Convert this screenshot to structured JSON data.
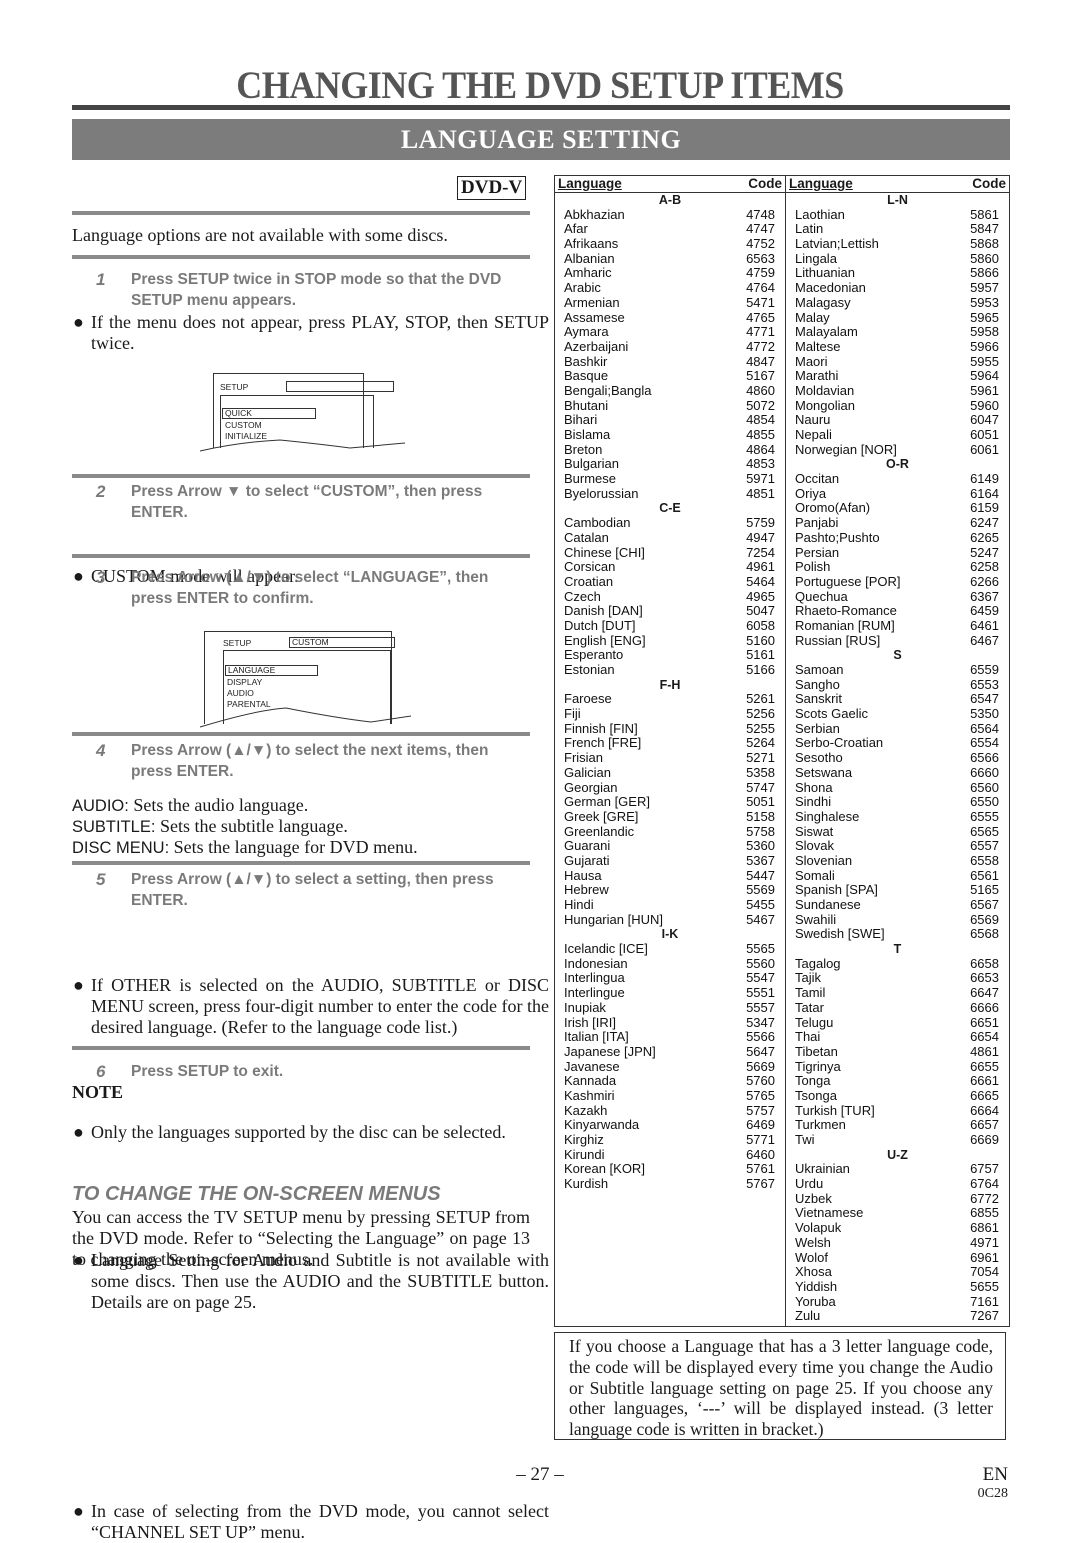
{
  "page": {
    "title": "CHANGING THE DVD SETUP ITEMS",
    "section": "LANGUAGE SETTING",
    "badge": "DVD-V",
    "intro": "Language options are not available with some discs.",
    "steps": [
      {
        "num": "1",
        "text": "Press SETUP twice in STOP mode so that the DVD SETUP menu appears."
      },
      {
        "num": "2",
        "text": "Press Arrow ▼ to select “CUSTOM”, then press ENTER."
      },
      {
        "num": "3",
        "text": "Press Arrow (▲/▼) to select “LANGUAGE”, then press ENTER to confirm."
      },
      {
        "num": "4",
        "text": "Press Arrow (▲/▼) to select the next items, then press ENTER."
      },
      {
        "num": "5",
        "text": "Press Arrow (▲/▼) to select a setting, then press ENTER."
      },
      {
        "num": "6",
        "text": "Press SETUP to exit."
      }
    ],
    "bullets": {
      "step1": "If the menu does not appear, press PLAY, STOP, then SETUP twice.",
      "step2": "CUSTOM mode will appear.",
      "step5a": "If OTHER is selected on the AUDIO, SUBTITLE or DISC MENU screen, press four-digit number to enter the code for the desired language. (Refer to the language code list.)",
      "step5b": "Only the languages supported by the disc can be selected."
    },
    "bullet_glyph": "●",
    "definitions": [
      {
        "term": "AUDIO:",
        "desc": "Sets the audio language."
      },
      {
        "term": "SUBTITLE:",
        "desc": "Sets the subtitle language."
      },
      {
        "term": "DISC MENU:",
        "desc": "Sets the language for DVD menu."
      }
    ],
    "osd1": {
      "header": "SETUP",
      "header_value": "",
      "items": [
        "QUICK",
        "CUSTOM",
        "INITIALIZE"
      ],
      "selected": "QUICK"
    },
    "osd2": {
      "header": "SETUP",
      "header_value": "CUSTOM",
      "items": [
        "LANGUAGE",
        "DISPLAY",
        "AUDIO",
        "PARENTAL"
      ],
      "selected": "LANGUAGE"
    },
    "note": {
      "heading": "NOTE",
      "text": "Language Setting for Audio and Subtitle is not available with some discs. Then use the AUDIO and the SUBTITLE button. Details are on page 25."
    },
    "onscreen": {
      "heading": "TO CHANGE THE ON-SCREEN MENUS",
      "text": "You can access the TV SETUP menu by pressing SETUP from the DVD mode. Refer to “Selecting the Language” on page 13 to changing the on-screen menus.",
      "bullet": "In case of selecting from the DVD mode, you cannot select “CHANNEL SET UP” menu."
    },
    "info_box": "If you choose a Language that has a 3 letter language code, the code will be displayed every time you change the Audio or Subtitle language setting on page 25. If you choose any other languages, ‘---’ will be displayed instead. (3 letter language code is written in bracket.)",
    "footer": {
      "page_number": "– 27 –",
      "lang": "EN",
      "model": "0C28"
    }
  },
  "table": {
    "header_language": "Language",
    "header_code": "Code",
    "columns": [
      [
        {
          "group": "A-B"
        },
        [
          "Abkhazian",
          "4748"
        ],
        [
          "Afar",
          "4747"
        ],
        [
          "Afrikaans",
          "4752"
        ],
        [
          "Albanian",
          "6563"
        ],
        [
          "Amharic",
          "4759"
        ],
        [
          "Arabic",
          "4764"
        ],
        [
          "Armenian",
          "5471"
        ],
        [
          "Assamese",
          "4765"
        ],
        [
          "Aymara",
          "4771"
        ],
        [
          "Azerbaijani",
          "4772"
        ],
        [
          "Bashkir",
          "4847"
        ],
        [
          "Basque",
          "5167"
        ],
        [
          "Bengali;Bangla",
          "4860"
        ],
        [
          "Bhutani",
          "5072"
        ],
        [
          "Bihari",
          "4854"
        ],
        [
          "Bislama",
          "4855"
        ],
        [
          "Breton",
          "4864"
        ],
        [
          "Bulgarian",
          "4853"
        ],
        [
          "Burmese",
          "5971"
        ],
        [
          "Byelorussian",
          "4851"
        ],
        {
          "group": "C-E"
        },
        [
          "Cambodian",
          "5759"
        ],
        [
          "Catalan",
          "4947"
        ],
        [
          "Chinese [CHI]",
          "7254"
        ],
        [
          "Corsican",
          "4961"
        ],
        [
          "Croatian",
          "5464"
        ],
        [
          "Czech",
          "4965"
        ],
        [
          "Danish [DAN]",
          "5047"
        ],
        [
          "Dutch [DUT]",
          "6058"
        ],
        [
          "English [ENG]",
          "5160"
        ],
        [
          "Esperanto",
          "5161"
        ],
        [
          "Estonian",
          "5166"
        ],
        {
          "group": "F-H"
        },
        [
          "Faroese",
          "5261"
        ],
        [
          "Fiji",
          "5256"
        ],
        [
          "Finnish [FIN]",
          "5255"
        ],
        [
          "French [FRE]",
          "5264"
        ],
        [
          "Frisian",
          "5271"
        ],
        [
          "Galician",
          "5358"
        ],
        [
          "Georgian",
          "5747"
        ],
        [
          "German [GER]",
          "5051"
        ],
        [
          "Greek [GRE]",
          "5158"
        ],
        [
          "Greenlandic",
          "5758"
        ],
        [
          "Guarani",
          "5360"
        ],
        [
          "Gujarati",
          "5367"
        ],
        [
          "Hausa",
          "5447"
        ],
        [
          "Hebrew",
          "5569"
        ],
        [
          "Hindi",
          "5455"
        ],
        [
          "Hungarian [HUN]",
          "5467"
        ],
        {
          "group": "I-K"
        },
        [
          "Icelandic [ICE]",
          "5565"
        ],
        [
          "Indonesian",
          "5560"
        ],
        [
          "Interlingua",
          "5547"
        ],
        [
          "Interlingue",
          "5551"
        ],
        [
          "Inupiak",
          "5557"
        ],
        [
          "Irish [IRI]",
          "5347"
        ],
        [
          "Italian [ITA]",
          "5566"
        ],
        [
          "Japanese [JPN]",
          "5647"
        ],
        [
          "Javanese",
          "5669"
        ],
        [
          "Kannada",
          "5760"
        ],
        [
          "Kashmiri",
          "5765"
        ],
        [
          "Kazakh",
          "5757"
        ],
        [
          "Kinyarwanda",
          "6469"
        ],
        [
          "Kirghiz",
          "5771"
        ],
        [
          "Kirundi",
          "6460"
        ],
        [
          "Korean [KOR]",
          "5761"
        ],
        [
          "Kurdish",
          "5767"
        ]
      ],
      [
        {
          "group": "L-N"
        },
        [
          "Laothian",
          "5861"
        ],
        [
          "Latin",
          "5847"
        ],
        [
          "Latvian;Lettish",
          "5868"
        ],
        [
          "Lingala",
          "5860"
        ],
        [
          "Lithuanian",
          "5866"
        ],
        [
          "Macedonian",
          "5957"
        ],
        [
          "Malagasy",
          "5953"
        ],
        [
          "Malay",
          "5965"
        ],
        [
          "Malayalam",
          "5958"
        ],
        [
          "Maltese",
          "5966"
        ],
        [
          "Maori",
          "5955"
        ],
        [
          "Marathi",
          "5964"
        ],
        [
          "Moldavian",
          "5961"
        ],
        [
          "Mongolian",
          "5960"
        ],
        [
          "Nauru",
          "6047"
        ],
        [
          "Nepali",
          "6051"
        ],
        [
          "Norwegian [NOR]",
          "6061"
        ],
        {
          "group": "O-R"
        },
        [
          "Occitan",
          "6149"
        ],
        [
          "Oriya",
          "6164"
        ],
        [
          "Oromo(Afan)",
          "6159"
        ],
        [
          "Panjabi",
          "6247"
        ],
        [
          "Pashto;Pushto",
          "6265"
        ],
        [
          "Persian",
          "5247"
        ],
        [
          "Polish",
          "6258"
        ],
        [
          "Portuguese [POR]",
          "6266"
        ],
        [
          "Quechua",
          "6367"
        ],
        [
          "Rhaeto-Romance",
          "6459"
        ],
        [
          "Romanian [RUM]",
          "6461"
        ],
        [
          "Russian [RUS]",
          "6467"
        ],
        {
          "group": "S"
        },
        [
          "Samoan",
          "6559"
        ],
        [
          "Sangho",
          "6553"
        ],
        [
          "Sanskrit",
          "6547"
        ],
        [
          "Scots Gaelic",
          "5350"
        ],
        [
          "Serbian",
          "6564"
        ],
        [
          "Serbo-Croatian",
          "6554"
        ],
        [
          "Sesotho",
          "6566"
        ],
        [
          "Setswana",
          "6660"
        ],
        [
          "Shona",
          "6560"
        ],
        [
          "Sindhi",
          "6550"
        ],
        [
          "Singhalese",
          "6555"
        ],
        [
          "Siswat",
          "6565"
        ],
        [
          "Slovak",
          "6557"
        ],
        [
          "Slovenian",
          "6558"
        ],
        [
          "Somali",
          "6561"
        ],
        [
          "Spanish [SPA]",
          "5165"
        ],
        [
          "Sundanese",
          "6567"
        ],
        [
          "Swahili",
          "6569"
        ],
        [
          "Swedish [SWE]",
          "6568"
        ],
        {
          "group": "T"
        },
        [
          "Tagalog",
          "6658"
        ],
        [
          "Tajik",
          "6653"
        ],
        [
          "Tamil",
          "6647"
        ],
        [
          "Tatar",
          "6666"
        ],
        [
          "Telugu",
          "6651"
        ],
        [
          "Thai",
          "6654"
        ],
        [
          "Tibetan",
          "4861"
        ],
        [
          "Tigrinya",
          "6655"
        ],
        [
          "Tonga",
          "6661"
        ],
        [
          "Tsonga",
          "6665"
        ],
        [
          "Turkish [TUR]",
          "6664"
        ],
        [
          "Turkmen",
          "6657"
        ],
        [
          "Twi",
          "6669"
        ],
        {
          "group": "U-Z"
        },
        [
          "Ukrainian",
          "6757"
        ],
        [
          "Urdu",
          "6764"
        ],
        [
          "Uzbek",
          "6772"
        ],
        [
          "Vietnamese",
          "6855"
        ],
        [
          "Volapuk",
          "6861"
        ],
        [
          "Welsh",
          "4971"
        ],
        [
          "Wolof",
          "6961"
        ],
        [
          "Xhosa",
          "7054"
        ],
        [
          "Yiddish",
          "5655"
        ],
        [
          "Yoruba",
          "7161"
        ],
        [
          "Zulu",
          "7267"
        ]
      ]
    ]
  }
}
